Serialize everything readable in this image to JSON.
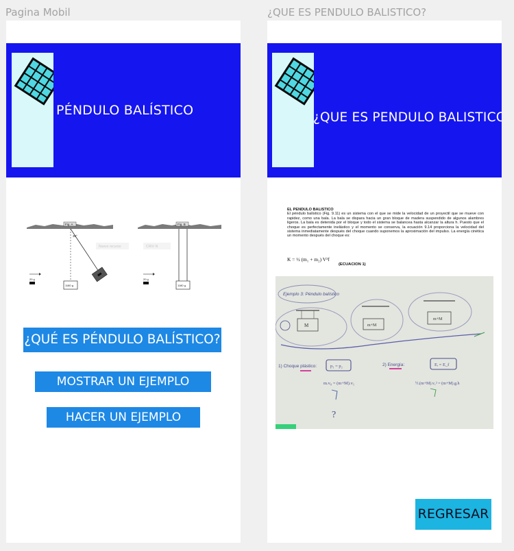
{
  "frames": {
    "left": {
      "label": "Pagina Mobil",
      "banner_title": "PÉNDULO BALÍSTICO",
      "figures": {
        "fig_a_label": "Fig. A",
        "fig_b_label": "Fig. B",
        "angle": "30°",
        "bullet_mass_a": "20 g",
        "bullet_mass_b": "20 g",
        "block_mass_a": "1180 g",
        "block_mass_b": "1180 g",
        "faint_text_1": "Nuevo recurso",
        "faint_text_2": "CRIV·N"
      },
      "buttons": {
        "what_is": "¿QUÉ ES PÉNDULO BALÍSTICO?",
        "show_example": "MOSTRAR UN EJEMPLO",
        "do_example": "HACER UN EJEMPLO"
      }
    },
    "right": {
      "label": "¿QUE ES PENDULO BALISTICO?",
      "banner_title": "¿QUE ES PENDULO BALISTICO?",
      "doc": {
        "heading": "EL PENDULO BALISTICO",
        "body": "El péndulo balístico (Fig. 9.11) es un sistema con el que se mide la velocidad de un proyectil que se mueve con rapidez, como una bala. La bala se dispara hacia un gran bloque de madera suspendido de algunos alambres ligeros. La bala es detenida por el bloque y todo el sistema se balancea hasta alcanzar la altura h. Puesto que el choque es perfectamente inelástico y el momento se conserva, la ecuación 9.14 proporciona la velocidad del sistema inmediatamente después del choque cuando suponemos la aproximación del impulso. La energía cinética un momento después del choque es:",
        "formula": "K = ½ (m₁ + m₂) V²f",
        "equation_label": "(ECUACION 1)"
      },
      "photo": {
        "example_label": "Ejemplo 3: Péndulo balístico",
        "block_m": "M",
        "block_mm": "m+M",
        "block_mm2": "m+M",
        "step1": "1) Choque plástico:",
        "step1_formula": "p₁ = p₂",
        "step1_eq": "m.v₀ = (m+M).v₁",
        "step2": "2) Energía:",
        "step2_formula": "Eᵢ = E_f",
        "step2_eq": "½.(m+M).v₁² = (m+M).g.h",
        "question_mark": "?"
      },
      "buttons": {
        "back": "REGRESAR"
      }
    }
  },
  "colors": {
    "background": "#f0f0f0",
    "banner": "#1515f0",
    "logo_panel": "#d8f8fa",
    "button_blue": "#1e88e5",
    "back_button": "#1cb4e0"
  }
}
